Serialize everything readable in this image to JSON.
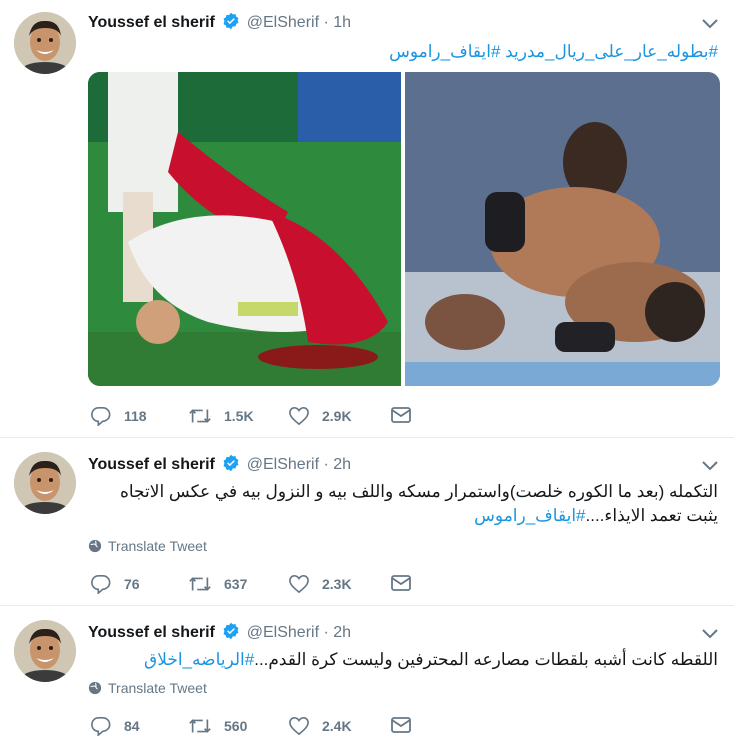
{
  "tweets": [
    {
      "name": "Youssef el sherif",
      "handle": "@ElSherif",
      "dot": "·",
      "time": "1h",
      "text_hashtags": "#بطوله_عار_على_ريال_مدريد #ايقاف_راموس",
      "replies": "118",
      "retweets": "1.5K",
      "likes": "2.9K"
    },
    {
      "name": "Youssef el sherif",
      "handle": "@ElSherif",
      "dot": "·",
      "time": "2h",
      "text_line1": "التكمله (بعد ما الكوره خلصت)واستمرار مسكه واللف بيه و النزول بيه في عكس الاتجاه",
      "text_line2_plain": "يثبت تعمد الايذاء....",
      "text_line2_hashtag": "#ايقاف_راموس",
      "translate": "Translate Tweet",
      "replies": "76",
      "retweets": "637",
      "likes": "2.3K"
    },
    {
      "name": "Youssef el sherif",
      "handle": "@ElSherif",
      "dot": "·",
      "time": "2h",
      "text_plain": "اللقطه كانت أشبه بلقطات مصارعه المحترفين وليست كرة القدم...",
      "text_hashtag": "#الرياضه_اخلاق",
      "translate": "Translate Tweet",
      "replies": "84",
      "retweets": "560",
      "likes": "2.4K"
    }
  ],
  "icons": {
    "reply": "reply-icon",
    "retweet": "retweet-icon",
    "like": "like-icon",
    "message": "direct-message-icon",
    "verified": "verified-badge-icon",
    "caret": "chevron-down-icon",
    "globe": "globe-icon"
  },
  "colors": {
    "accent": "#1da1f2",
    "hashtag": "#1b95e0",
    "muted": "#657786",
    "separator": "#e6ecf0"
  }
}
